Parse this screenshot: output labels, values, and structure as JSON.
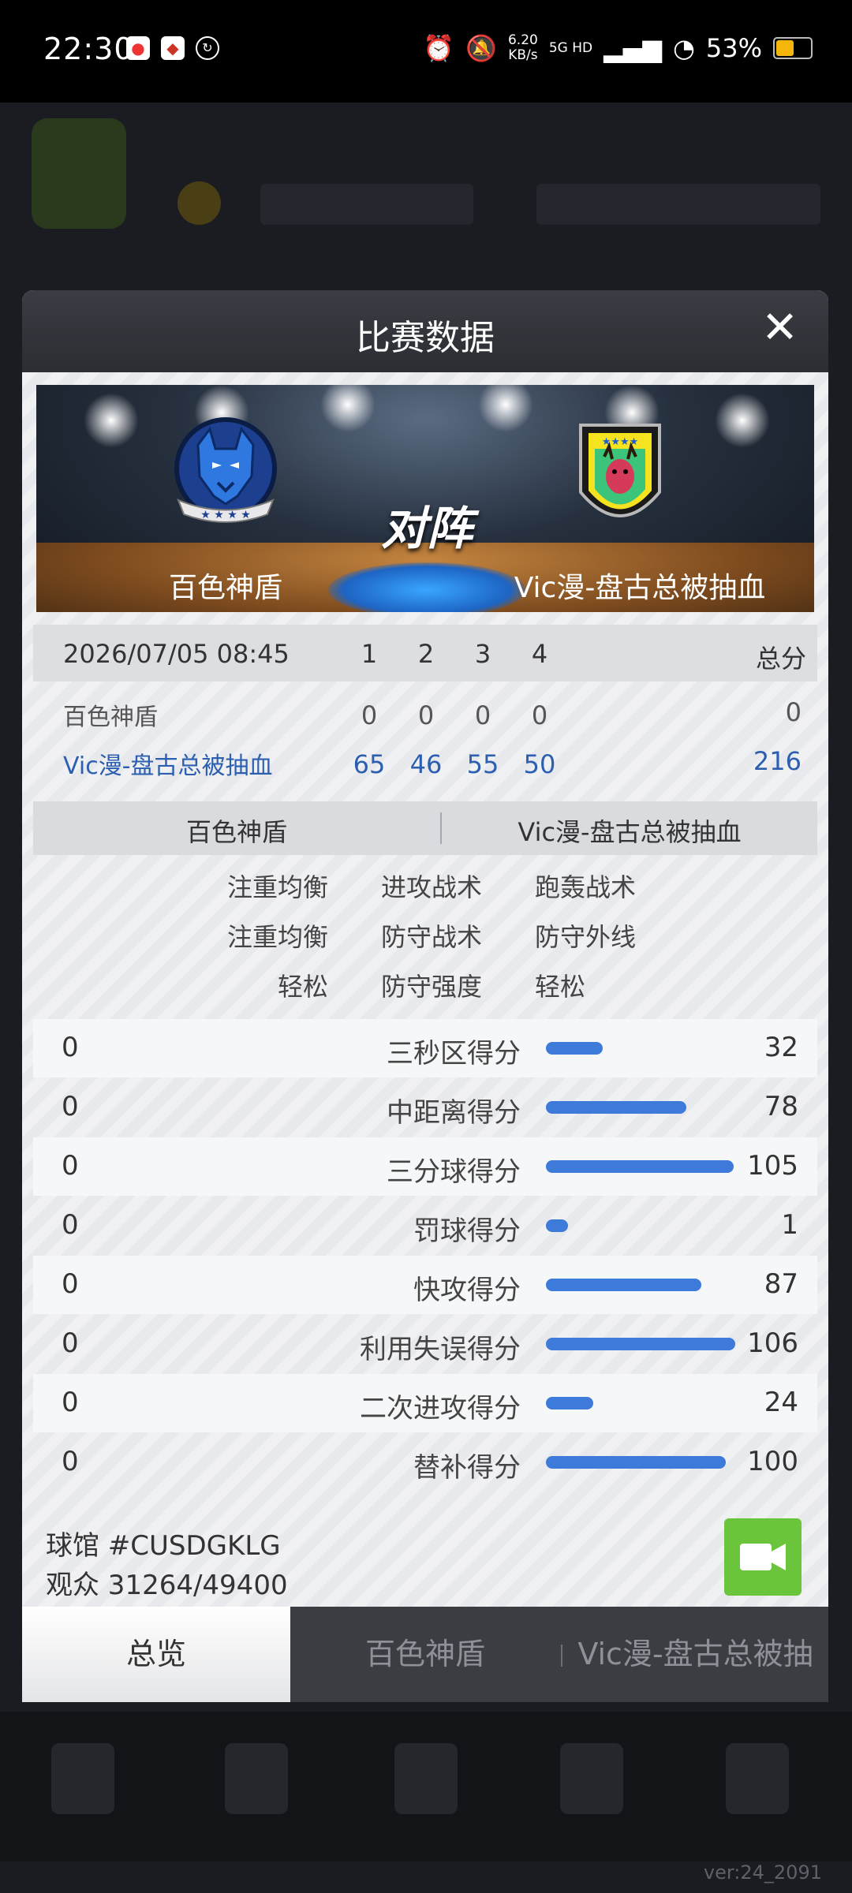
{
  "status_bar": {
    "time": "22:30",
    "net_speed_value": "6.20",
    "net_speed_unit": "KB/s",
    "signal_label": "5G HD",
    "battery": "53%",
    "battery_level": 0.53
  },
  "background": {
    "version": "ver:24_2091"
  },
  "modal": {
    "title": "比赛数据",
    "close_icon": "close-icon"
  },
  "banner": {
    "team_a": "百色神盾",
    "team_b": "Vic漫-盘古总被抽血",
    "vs_label": "对阵",
    "team_a_logo": "wolf-logo-icon",
    "team_b_logo": "deer-logo-icon"
  },
  "scoreboard": {
    "date": "2026/07/05 08:45",
    "quarters": [
      "1",
      "2",
      "3",
      "4"
    ],
    "total_label": "总分",
    "rows": [
      {
        "team": "百色神盾",
        "q": [
          "0",
          "0",
          "0",
          "0"
        ],
        "total": "0"
      },
      {
        "team": "Vic漫-盘古总被抽血",
        "q": [
          "65",
          "46",
          "55",
          "50"
        ],
        "total": "216"
      }
    ]
  },
  "compare": {
    "team_a": "百色神盾",
    "team_b": "Vic漫-盘古总被抽血",
    "tactics": [
      {
        "left": "注重均衡",
        "label": "进攻战术",
        "right": "跑轰战术"
      },
      {
        "left": "注重均衡",
        "label": "防守战术",
        "right": "防守外线"
      },
      {
        "left": "轻松",
        "label": "防守强度",
        "right": "轻松"
      }
    ]
  },
  "stats": [
    {
      "left": "0",
      "label": "三秒区得分",
      "right": "32",
      "level": 0.3
    },
    {
      "left": "0",
      "label": "中距离得分",
      "right": "78",
      "level": 0.74
    },
    {
      "left": "0",
      "label": "三分球得分",
      "right": "105",
      "level": 0.99
    },
    {
      "left": "0",
      "label": "罚球得分",
      "right": "1",
      "level": 0.1
    },
    {
      "left": "0",
      "label": "快攻得分",
      "right": "87",
      "level": 0.82
    },
    {
      "left": "0",
      "label": "利用失误得分",
      "right": "106",
      "level": 1.0
    },
    {
      "left": "0",
      "label": "二次进攻得分",
      "right": "24",
      "level": 0.25
    },
    {
      "left": "0",
      "label": "替补得分",
      "right": "100",
      "level": 0.95
    }
  ],
  "arena": {
    "venue": "球馆 #CUSDGKLG",
    "attendance": "观众 31264/49400"
  },
  "video_button_icon": "video-camera-icon",
  "tabs": [
    {
      "label": "总览",
      "active": true
    },
    {
      "label": "百色神盾",
      "active": false
    },
    {
      "label": "Vic漫-盘古总被抽",
      "active": false
    }
  ],
  "colors": {
    "accent_blue": "#3d7ad9",
    "video_green": "#6ac43c",
    "header_dark": "#2a2d32"
  }
}
